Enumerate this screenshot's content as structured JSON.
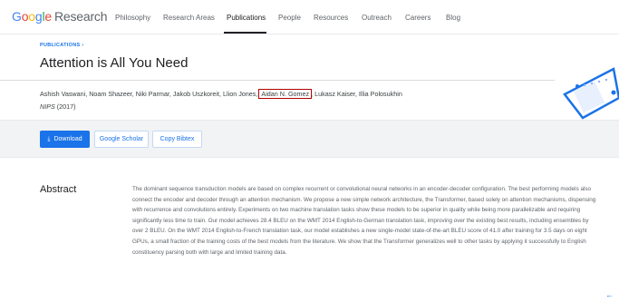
{
  "header": {
    "logo_text": "Google Research",
    "nav": [
      "Philosophy",
      "Research Areas",
      "Publications",
      "People",
      "Resources",
      "Outreach",
      "Careers",
      "Blog"
    ],
    "active_nav": "Publications"
  },
  "hero": {
    "breadcrumb": "PUBLICATIONS ›",
    "title": "Attention is All You Need",
    "authors": [
      "Ashish Vaswani",
      "Noam Shazeer",
      "Niki Parmar",
      "Jakob Uszkoreit",
      "Llion Jones",
      "Aidan N. Gomez",
      "Lukasz Kaiser",
      "Illia Polosukhin"
    ],
    "highlighted_author": "Aidan N. Gomez",
    "venue": "NIPS",
    "year": "(2017)"
  },
  "actions": {
    "download_label": "Download",
    "scholar_label": "Google Scholar",
    "bibtex_label": "Copy Bibtex"
  },
  "abstract": {
    "heading": "Abstract",
    "text": "The dominant sequence transduction models are based on complex recurrent or convolutional neural networks in an encoder-decoder configuration. The best performing models also connect the encoder and decoder through an attention mechanism. We propose a new simple network architecture, the Transformer, based solely on attention mechanisms, dispensing with recurrence and convolutions entirely. Experiments on two machine translation tasks show these models to be superior in quality while being more parallelizable and requiring significantly less time to train. Our model achieves 28.4 BLEU on the WMT 2014 English-to-German translation task, improving over the existing best results, including ensembles by over 2 BLEU. On the WMT 2014 English-to-French translation task, our model establishes a new single-model state-of-the-art BLEU score of 41.0 after training for 3.5 days on eight GPUs, a small fraction of the training costs of the best models from the literature. We show that the Transformer generalizes well to other tasks by applying it successfully to English constituency parsing both with large and limited training data."
  },
  "icons": {
    "download": "download-icon",
    "back": "back-arrow-icon"
  },
  "colors": {
    "accent": "#1a73e8",
    "highlight_box": "#b00000"
  }
}
